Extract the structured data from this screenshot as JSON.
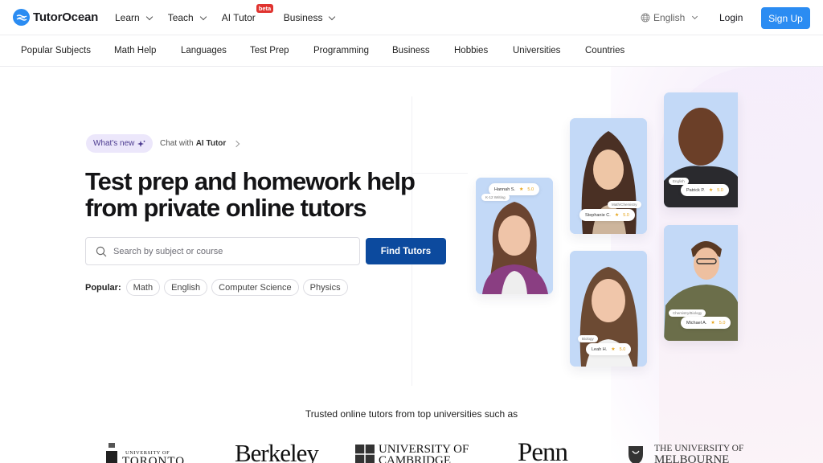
{
  "header": {
    "brand": "TutorOcean",
    "nav": [
      {
        "label": "Learn",
        "has_dropdown": true
      },
      {
        "label": "Teach",
        "has_dropdown": true
      },
      {
        "label": "AI Tutor",
        "badge": "beta",
        "has_dropdown": false
      },
      {
        "label": "Business",
        "has_dropdown": true
      }
    ],
    "language": "English",
    "login": "Login",
    "signup": "Sign Up",
    "colors": {
      "brand": "#2b8cf2",
      "beta_badge": "#e0332f"
    }
  },
  "subject_nav": [
    "Popular Subjects",
    "Math Help",
    "Languages",
    "Test Prep",
    "Programming",
    "Business",
    "Hobbies",
    "Universities",
    "Countries"
  ],
  "hero": {
    "whats_new": "What's new",
    "chat_prefix": "Chat with",
    "chat_strong": "AI Tutor",
    "title_line1": "Test prep and homework help",
    "title_line2": "from private online tutors",
    "search_placeholder": "Search by subject or course",
    "find_button": "Find Tutors",
    "popular_label": "Popular:",
    "popular_chips": [
      "Math",
      "English",
      "Computer Science",
      "Physics"
    ],
    "colors": {
      "find_button": "#0c4a9e",
      "whats_new_bg": "#ece7fb"
    }
  },
  "tutors": [
    {
      "name": "Hannah S.",
      "subject": "K-12 Writing",
      "rating": "5.0"
    },
    {
      "name": "Stephanie C.",
      "subject": "Math/Chemistry",
      "rating": "5.0"
    },
    {
      "name": "Leah H.",
      "subject": "Biology",
      "rating": "5.0"
    },
    {
      "name": "Patrick P.",
      "subject": "English",
      "rating": "5.0"
    },
    {
      "name": "Michael A.",
      "subject": "Chemistry/Biology",
      "rating": "5.0"
    }
  ],
  "universities": {
    "heading": "Trusted online tutors from top universities such as",
    "logos": [
      {
        "line1": "UNIVERSITY OF",
        "line2": "TORONTO"
      },
      {
        "line1": "Berkeley",
        "line2": ""
      },
      {
        "line1": "UNIVERSITY OF",
        "line2": "CAMBRIDGE"
      },
      {
        "line1": "Penn",
        "line2": ""
      },
      {
        "line1": "THE UNIVERSITY OF",
        "line2": "MELBOURNE"
      }
    ]
  }
}
